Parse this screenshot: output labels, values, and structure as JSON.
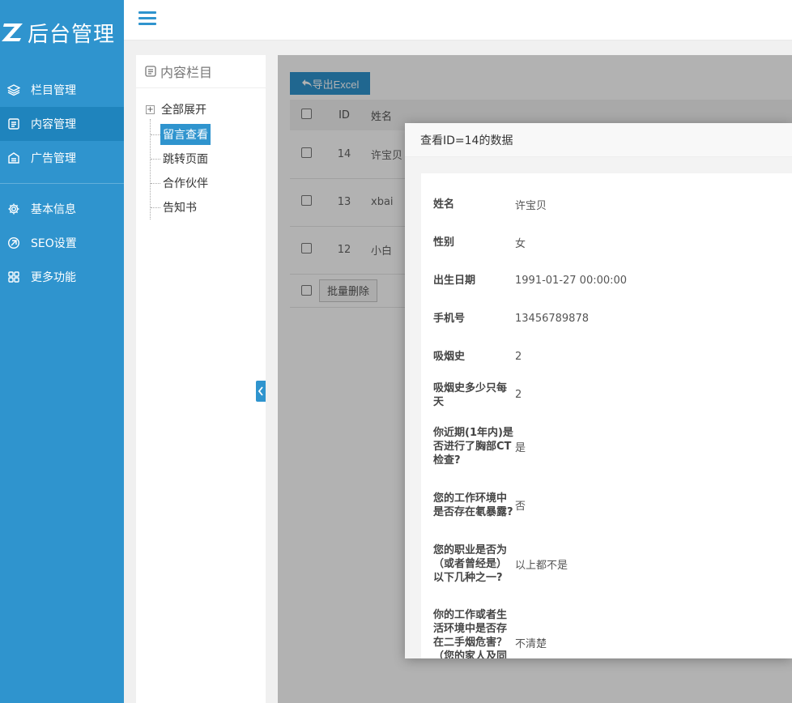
{
  "logo": {
    "text": "后台管理"
  },
  "sidebar": {
    "items": [
      {
        "label": "栏目管理",
        "icon": "layers-icon"
      },
      {
        "label": "内容管理",
        "icon": "document-icon",
        "active": true
      },
      {
        "label": "广告管理",
        "icon": "ad-icon"
      },
      {
        "label": "基本信息",
        "icon": "gear-icon"
      },
      {
        "label": "SEO设置",
        "icon": "seo-icon"
      },
      {
        "label": "更多功能",
        "icon": "grid-icon"
      }
    ]
  },
  "tree": {
    "title": "内容栏目",
    "root": "全部展开",
    "children": [
      "留言查看",
      "跳转页面",
      "合作伙伴",
      "告知书"
    ],
    "selected": "留言查看"
  },
  "toolbar": {
    "export_label": "导出Excel"
  },
  "table": {
    "headers": {
      "id": "ID",
      "name": "姓名"
    },
    "rows": [
      {
        "id": "14",
        "name": "许宝贝"
      },
      {
        "id": "13",
        "name": "xbai"
      },
      {
        "id": "12",
        "name": "小白"
      }
    ],
    "bulk_delete_label": "批量删除"
  },
  "modal": {
    "title": "查看ID=14的数据",
    "fields": [
      {
        "label": "姓名",
        "value": "许宝贝"
      },
      {
        "label": "性别",
        "value": "女"
      },
      {
        "label": "出生日期",
        "value": "1991-01-27 00:00:00"
      },
      {
        "label": "手机号",
        "value": "13456789878"
      },
      {
        "label": "吸烟史",
        "value": "2"
      },
      {
        "label": "吸烟史多少只每天",
        "value": "2"
      },
      {
        "label": "你近期(1年内)是否进行了胸部CT检查?",
        "value": "是"
      },
      {
        "label": "您的工作环境中是否存在氡暴露?",
        "value": "否"
      },
      {
        "label": "您的职业是否为（或者曾经是）以下几种之一?",
        "value": "以上都不是"
      },
      {
        "label": "你的工作或者生活环境中是否存在二手烟危害？（您的家人及同事或者朋",
        "value": "不清楚"
      }
    ]
  },
  "colors": {
    "primary": "#2f94ce",
    "active": "#1f84bd"
  }
}
